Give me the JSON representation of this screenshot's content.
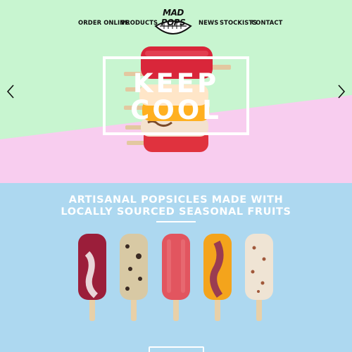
{
  "nav": {
    "left": [
      "ORDER ONLINE",
      "PRODUCTS"
    ],
    "right": [
      "NEWS",
      "STOCKISTS",
      "CONTACT"
    ],
    "logo": "MAD POPS"
  },
  "hero": {
    "line1": "KEEP",
    "line2": "COOL",
    "colors": {
      "mint": "#c8f5d0",
      "pink": "#f8cdef"
    }
  },
  "section": {
    "headline1": "ARTISANAL POPSICLES MADE WITH",
    "headline2": "LOCALLY SOURCED SEASONAL FRUITS",
    "background": "#add8f0"
  },
  "icons": [
    "chevron-left-icon",
    "chevron-right-icon"
  ]
}
